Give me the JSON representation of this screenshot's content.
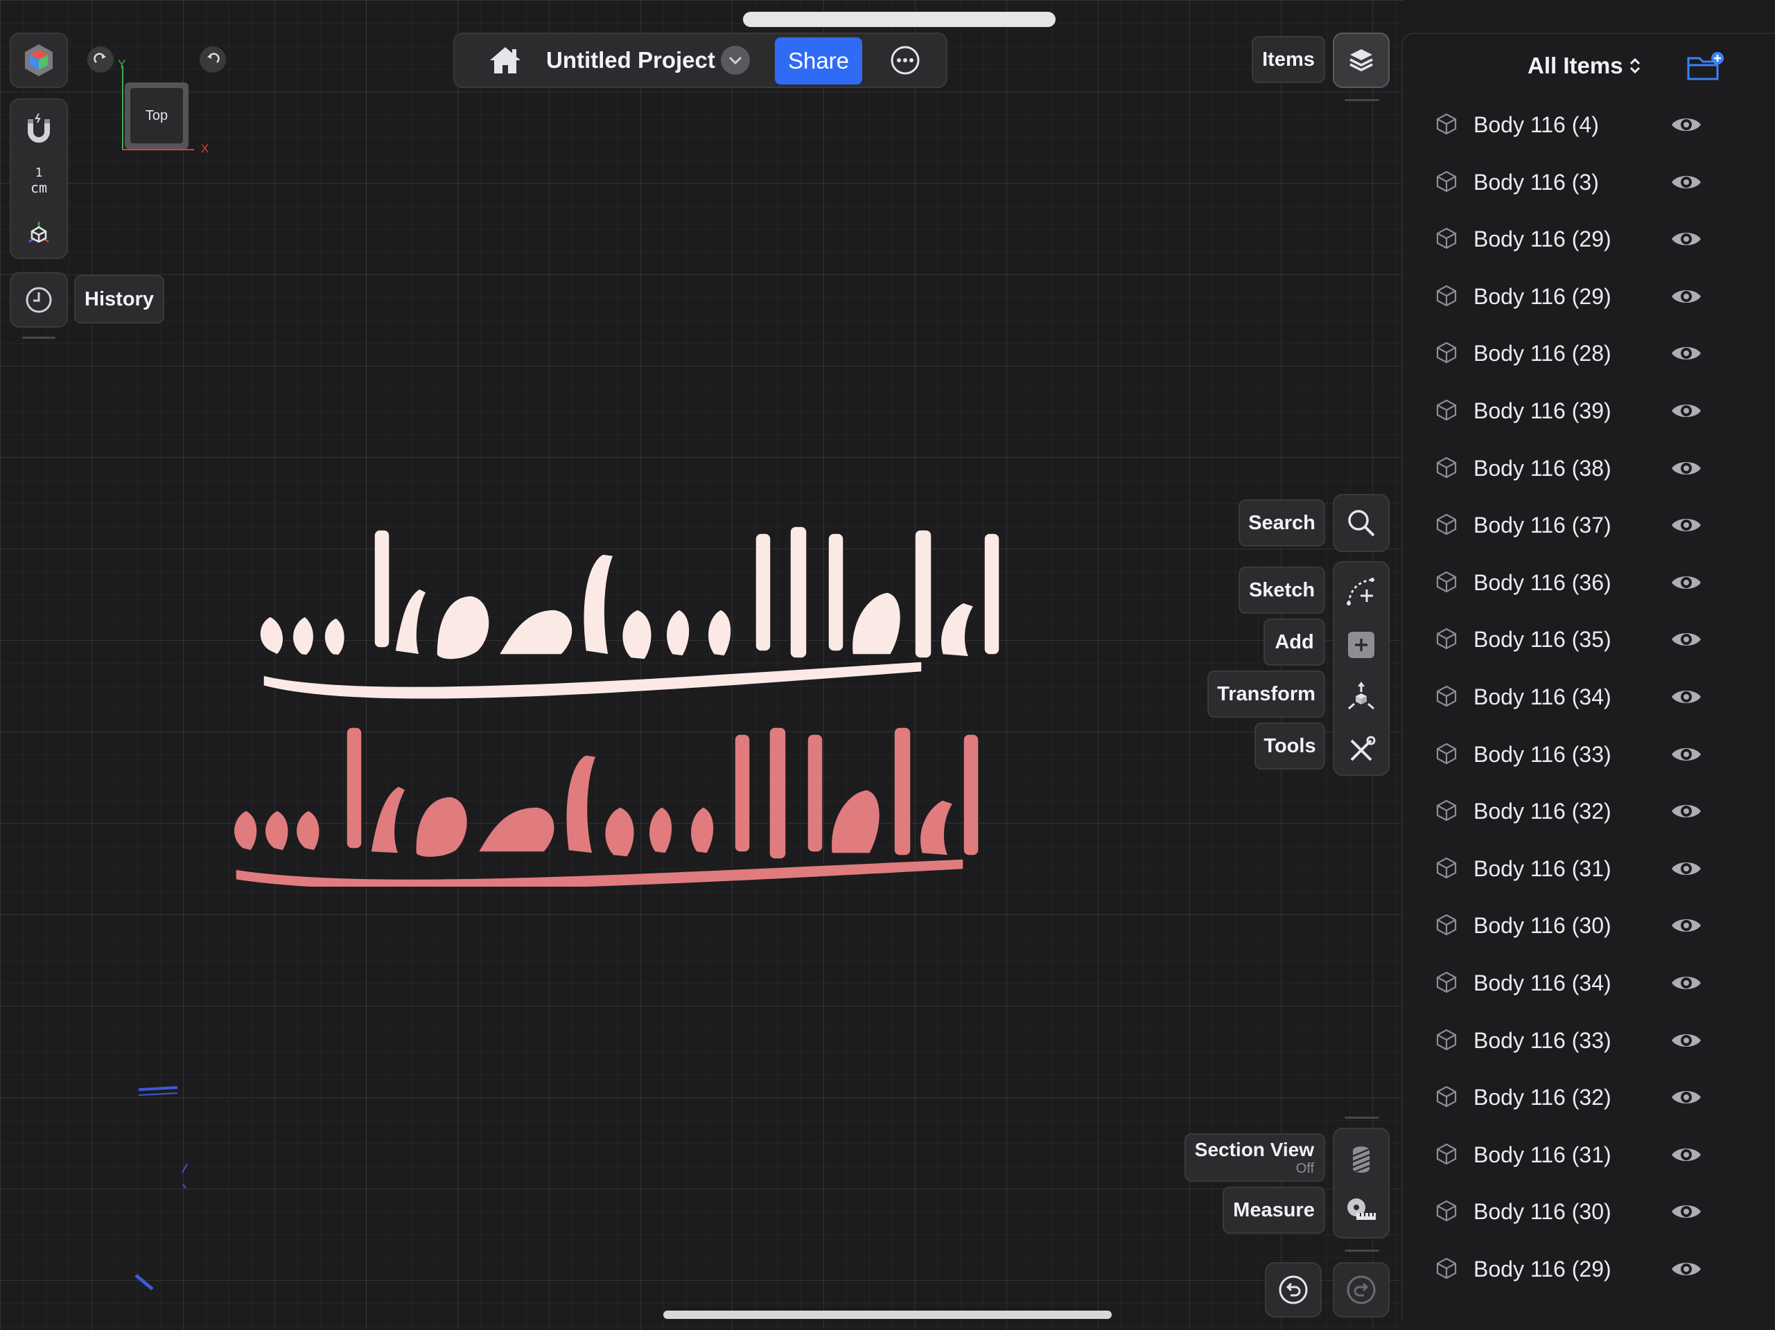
{
  "app": {
    "project_title": "Untitled Project",
    "share_label": "Share"
  },
  "left_toolbar": {
    "scale_value": "1",
    "scale_unit": "cm",
    "history_label": "History"
  },
  "view_cube": {
    "face_label": "Top",
    "axis_y": "Y",
    "axis_x": "X"
  },
  "right_tools": {
    "items_label": "Items",
    "search_label": "Search",
    "sketch_label": "Sketch",
    "add_label": "Add",
    "transform_label": "Transform",
    "tools_label": "Tools",
    "section_view_label": "Section View",
    "section_view_state": "Off",
    "measure_label": "Measure"
  },
  "items_panel": {
    "filter_label": "All Items",
    "items": [
      "Body 116 (4)",
      "Body 116 (3)",
      "Body 116 (29)",
      "Body 116 (29)",
      "Body 116 (28)",
      "Body 116 (39)",
      "Body 116 (38)",
      "Body 116 (37)",
      "Body 116 (36)",
      "Body 116 (35)",
      "Body 116 (34)",
      "Body 116 (33)",
      "Body 116 (32)",
      "Body 116 (31)",
      "Body 116 (30)",
      "Body 116 (34)",
      "Body 116 (33)",
      "Body 116 (32)",
      "Body 116 (31)",
      "Body 116 (30)",
      "Body 116 (29)"
    ]
  },
  "colors": {
    "accent": "#2f6bf4",
    "calligraphy_white": "#fbe9e6",
    "calligraphy_pink": "#e07c7e",
    "background": "#1c1c1e"
  },
  "icons": {
    "app_logo": "app-logo-icon",
    "snap": "magnet-icon",
    "axis": "axis-cube-icon",
    "history": "clock-icon",
    "home": "home-icon",
    "more": "ellipsis-circle-icon",
    "layers": "layers-icon",
    "new_folder": "folder-plus-icon",
    "body": "cube-outline-icon",
    "visibility": "eye-icon"
  }
}
